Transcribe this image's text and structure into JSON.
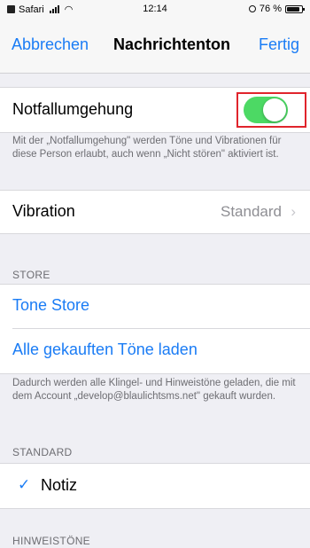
{
  "status_bar": {
    "carrier": "Safari",
    "time": "12:14",
    "battery_percent": "76 %",
    "icons": [
      "back-to-app-icon",
      "signal-icon",
      "wifi-icon",
      "alarm-icon",
      "battery-icon"
    ]
  },
  "nav": {
    "cancel": "Abbrechen",
    "title": "Nachrichtenton",
    "done": "Fertig"
  },
  "emergency_bypass": {
    "label": "Notfallumgehung",
    "enabled": true,
    "description": "Mit der „Notfallumgehung\" werden Töne und Vibrationen für diese Person erlaubt, auch wenn „Nicht stören\" aktiviert ist."
  },
  "vibration": {
    "label": "Vibration",
    "value": "Standard"
  },
  "store": {
    "header": "STORE",
    "tone_store": "Tone Store",
    "download_all": "Alle gekauften Töne laden",
    "footnote": "Dadurch werden alle Klingel- und Hinweistöne geladen, die mit dem Account „develop@blaulichtsms.net\" gekauft wurden."
  },
  "standard": {
    "header": "STANDARD",
    "selected_tone": "Notiz"
  },
  "alert_tones": {
    "header": "HINWEISTÖNE"
  },
  "colors": {
    "accent": "#1a7cf5",
    "toggle_on": "#4cd964",
    "highlight": "#e0242c",
    "background": "#efeff4"
  }
}
